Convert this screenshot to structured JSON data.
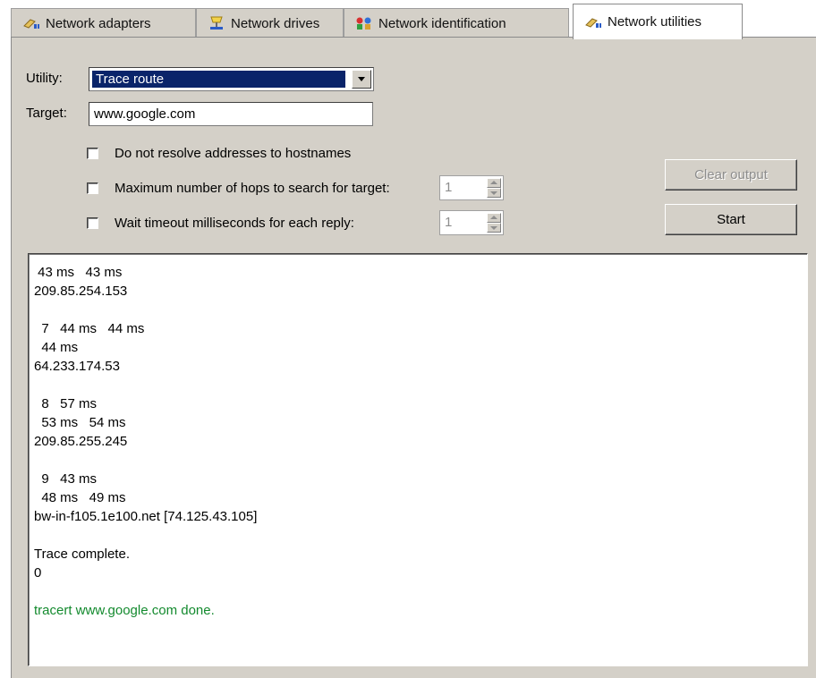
{
  "tabs": [
    {
      "label": "Network adapters",
      "icon": "network-adapter-icon",
      "active": false
    },
    {
      "label": "Network drives",
      "icon": "network-drive-icon",
      "active": false
    },
    {
      "label": "Network identification",
      "icon": "network-identification-icon",
      "active": false
    },
    {
      "label": "Network utilities",
      "icon": "network-utilities-icon",
      "active": true
    }
  ],
  "form": {
    "utility_label": "Utility:",
    "utility_value": "Trace route",
    "target_label": "Target:",
    "target_value": "www.google.com",
    "options": [
      {
        "label": "Do not resolve addresses to hostnames",
        "checked": false
      },
      {
        "label": "Maximum number of hops to search for target:",
        "checked": false,
        "value": "1"
      },
      {
        "label": "Wait timeout milliseconds for each reply:",
        "checked": false,
        "value": "1"
      }
    ]
  },
  "buttons": {
    "clear": "Clear output",
    "start": "Start"
  },
  "output": {
    "lines": [
      " 43 ms   43 ms",
      "209.85.254.153",
      "",
      "  7   44 ms   44 ms",
      "  44 ms",
      "64.233.174.53",
      "",
      "  8   57 ms",
      "  53 ms   54 ms",
      "209.85.255.245",
      "",
      "  9   43 ms",
      "  48 ms   49 ms",
      "bw-in-f105.1e100.net [74.125.43.105]",
      "",
      "Trace complete.",
      "0",
      ""
    ],
    "done_line": "tracert www.google.com done."
  },
  "colors": {
    "panel_bg": "#d4d0c8",
    "selection": "#0a246a",
    "done_text": "#138a2e"
  }
}
